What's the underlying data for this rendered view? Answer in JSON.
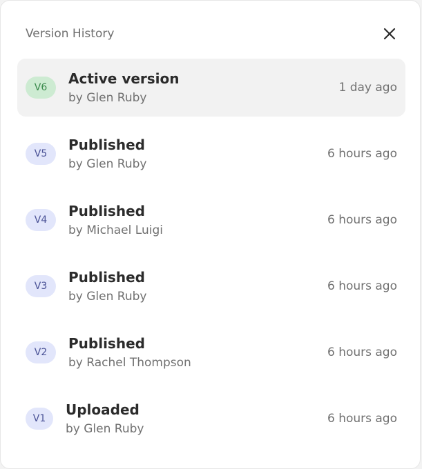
{
  "dialog": {
    "title": "Version History",
    "close_icon": "close-icon"
  },
  "colors": {
    "active_badge_bg": "#cdebd2",
    "active_badge_text": "#3a8a4c",
    "badge_bg": "#e2e6fb",
    "badge_text": "#4a5296",
    "active_row_bg": "#f2f2f2"
  },
  "versions": [
    {
      "badge": "V6",
      "title": "Active version",
      "author": "by Glen Ruby",
      "time": "1 day ago",
      "active": true
    },
    {
      "badge": "V5",
      "title": "Published",
      "author": "by Glen Ruby",
      "time": "6 hours ago",
      "active": false
    },
    {
      "badge": "V4",
      "title": "Published",
      "author": "by Michael Luigi",
      "time": "6 hours ago",
      "active": false
    },
    {
      "badge": "V3",
      "title": "Published",
      "author": "by Glen Ruby",
      "time": "6 hours ago",
      "active": false
    },
    {
      "badge": "V2",
      "title": "Published",
      "author": "by Rachel Thompson",
      "time": "6 hours ago",
      "active": false
    },
    {
      "badge": "V1",
      "title": "Uploaded",
      "author": "by Glen Ruby",
      "time": "6 hours ago",
      "active": false
    }
  ]
}
